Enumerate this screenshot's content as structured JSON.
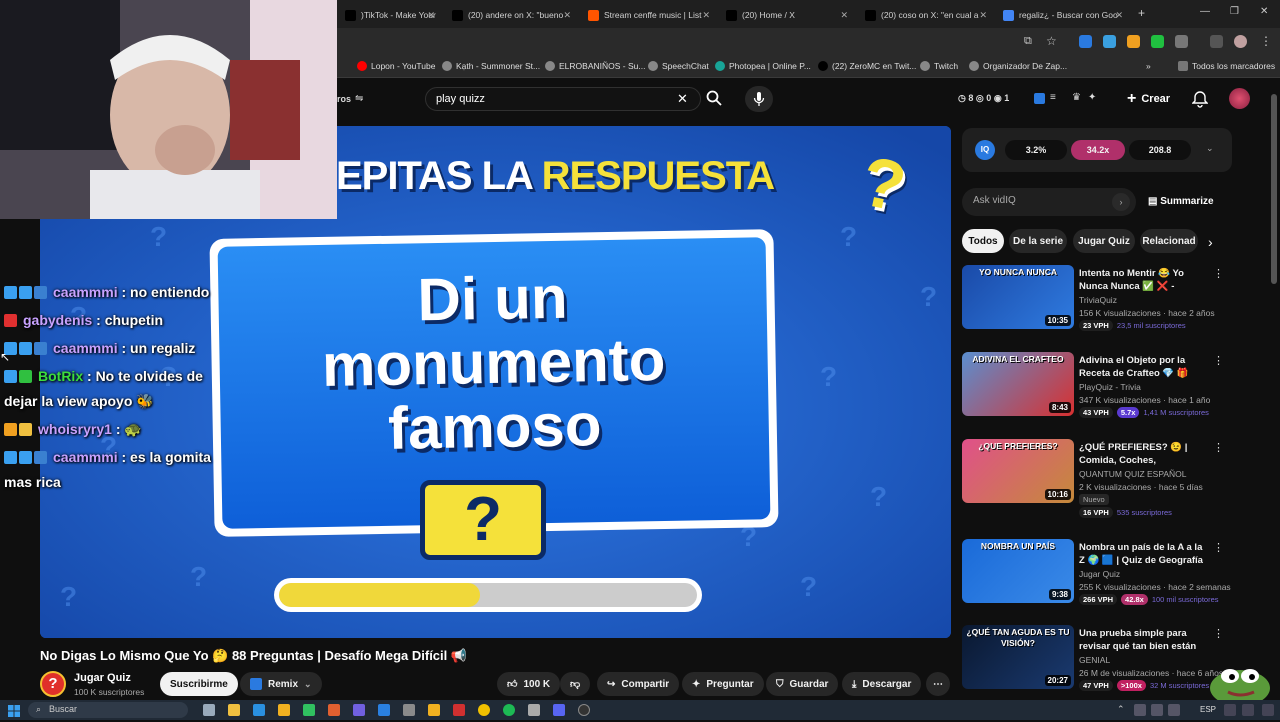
{
  "browser": {
    "tabs": [
      {
        "label": ")TikTok - Make Your",
        "color": "#000000"
      },
      {
        "label": "(20) andere on X: \"bueno",
        "color": "#000000"
      },
      {
        "label": "Stream cenffe music | List",
        "color": "#ff5500"
      },
      {
        "label": "(20) Home / X",
        "color": "#000000"
      },
      {
        "label": "(20) coso on X: \"en cual a",
        "color": "#000000"
      },
      {
        "label": "regaliz¿ - Buscar con Goo",
        "color": "#4285f4"
      }
    ],
    "new_tab": "+",
    "bookmarks": [
      {
        "label": "Lopon - YouTube",
        "color": "#ff0000"
      },
      {
        "label": "Kạth - Summoner St...",
        "color": "#888888"
      },
      {
        "label": "ELROBANIÑOS - Su...",
        "color": "#888888"
      },
      {
        "label": "SpeechChat",
        "color": "#888888"
      },
      {
        "label": "Photopea | Online P...",
        "color": "#18a497"
      },
      {
        "label": "(22) ZeroMC en Twit...",
        "color": "#000000"
      },
      {
        "label": "Twitch",
        "color": "#888888"
      },
      {
        "label": "Organizador De Zap...",
        "color": "#888888"
      }
    ],
    "bookmarks_more": "»",
    "all_bookmarks": "Todos los marcadores"
  },
  "youtube": {
    "filters_partial": "ros",
    "search_value": "play quizz",
    "header_counters": {
      "views": "8",
      "a": "0",
      "b": "1"
    },
    "create_label": "Crear",
    "vidiq": {
      "logo": "IQ",
      "stat1": "3.2%",
      "stat2": "34.2x",
      "stat3": "208.8",
      "ask_placeholder": "Ask vidIQ",
      "summarize": "Summarize"
    },
    "chips": [
      "Todos",
      "De la serie",
      "Jugar Quiz",
      "Relacionad"
    ],
    "video": {
      "title": "No Digas Lo Mismo Que Yo 🤔 88 Preguntas | Desafío Mega Difícil 📢",
      "channel": "Jugar Quiz",
      "subs": "100 K suscriptores",
      "subscribe": "Suscribirme",
      "remix": "Remix",
      "likes": "100 K",
      "share": "Compartir",
      "ask": "Preguntar",
      "save": "Guardar",
      "download": "Descargar",
      "more": "⋯"
    },
    "player": {
      "banner_text_a": "EPITAS LA ",
      "banner_text_b": "RESPUESTA",
      "card_text": [
        "Di un",
        "monumento",
        "famoso"
      ],
      "question_mark": "?",
      "progress": 0.48
    },
    "recommendations": [
      {
        "title": "Intenta no Mentir 😂 Yo Nunca Nunca ✅ ❌ - TriviaQuiz Part...",
        "channel": "TriviaQuiz",
        "meta": "156 K visualizaciones · hace 2 años",
        "vph": "23 VPH",
        "extra": "",
        "subs": "23,5 mil suscriptores",
        "duration": "10:35",
        "thumb_text": "YO NUNCA NUNCA",
        "c1": "#1a4aa8",
        "c2": "#2f7be0"
      },
      {
        "title": "Adivina el Objeto por la Receta de Crafteo 💎 🎁 ¿Cuánto ...",
        "channel": "PlayQuiz - Trivia",
        "meta": "347 K visualizaciones · hace 1 año",
        "vph": "43 VPH",
        "extra": "5.7x",
        "subs": "1,41 M suscriptores",
        "duration": "8:43",
        "thumb_text": "ADIVINA EL CRAFTEO",
        "c1": "#5a8fd0",
        "c2": "#d83030"
      },
      {
        "title": "¿QUÉ PREFIERES? 😉 | Comida, Coches, Superpoderes y ...",
        "channel": "QUANTUM QUIZ ESPAÑOL",
        "meta": "2 K visualizaciones · hace 5 días",
        "badge": "Nuevo",
        "vph": "16 VPH",
        "extra": "",
        "subs": "535 suscriptores",
        "duration": "10:16",
        "thumb_text": "¿QUE PREFIERES?",
        "c1": "#e0508a",
        "c2": "#c58a3a"
      },
      {
        "title": "Nombra un país de la A a la Z 🌍 🟦 | Quiz de Geografía",
        "channel": "Jugar Quiz",
        "meta": "255 K visualizaciones · hace 2 semanas",
        "vph": "266 VPH",
        "extra": "42.8x",
        "subs": "100 mil suscriptores",
        "duration": "9:38",
        "thumb_text": "NOMBRA UN PAÍS",
        "c1": "#1a6ad8",
        "c2": "#3a8ae8"
      },
      {
        "title": "Una prueba simple para revisar qué tan bien están tus ojos",
        "channel": "GENIAL",
        "meta": "26 M de visualizaciones · hace 6 años",
        "vph": "47 VPH",
        "extra": ">100x",
        "subs": "32 M suscriptores",
        "duration": "20:27",
        "thumb_text": "¿QUÉ TAN AGUDA ES TU VISIÓN?",
        "c1": "#0a1830",
        "c2": "#1a3a70"
      }
    ]
  },
  "chat": [
    {
      "user": "caammmi",
      "color": "#c8a2ff",
      "msg": ": no entiendo",
      "msg2": ""
    },
    {
      "user": "gabydenis",
      "color": "#c8a2ff",
      "msg": ": chupetin",
      "msg2": ""
    },
    {
      "user": "caammmi",
      "color": "#c8a2ff",
      "msg": ": un regaliz",
      "msg2": ""
    },
    {
      "user": "BotRix",
      "color": "#3cdc3c",
      "msg": ": No te olvides de",
      "msg2": "dejar la view apoyo 🐝"
    },
    {
      "user": "whoisryry1",
      "color": "#c8a2ff",
      "msg": ": 🐢",
      "msg2": ""
    },
    {
      "user": "caammmi",
      "color": "#c8a2ff",
      "msg": ": es la gomita",
      "msg2": "mas rica"
    }
  ],
  "taskbar": {
    "search": "Buscar",
    "lang": "ESP"
  }
}
